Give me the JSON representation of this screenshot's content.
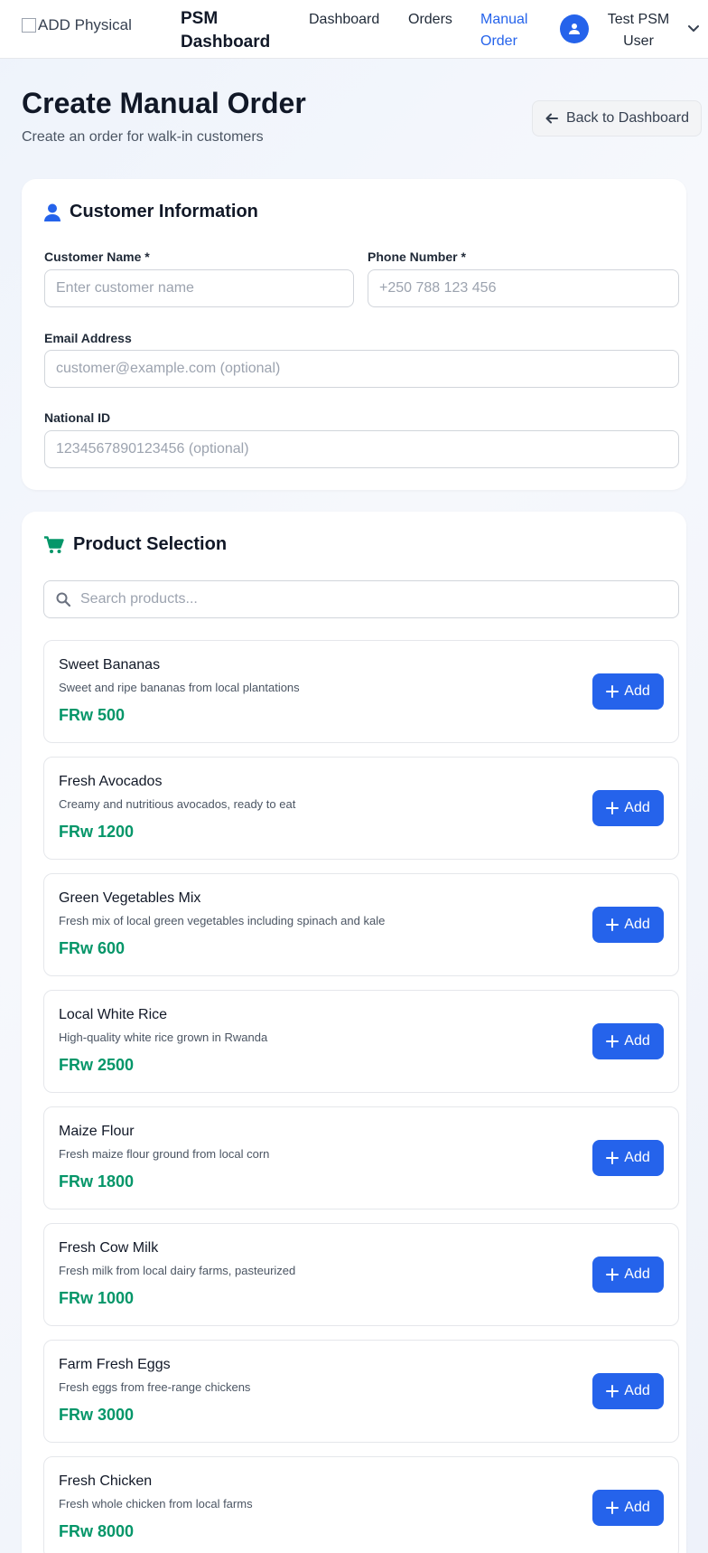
{
  "nav": {
    "logo_alt": "ADD Physical",
    "brand": "PSM Dashboard",
    "links": [
      {
        "label": "Dashboard",
        "active": false
      },
      {
        "label": "Orders",
        "active": false
      },
      {
        "label": "Manual Order",
        "active": true
      }
    ],
    "user_name": "Test PSM User",
    "user_icon": "user-circle-icon",
    "menu_icon": "chevron-down-icon"
  },
  "header": {
    "title": "Create Manual Order",
    "subtitle": "Create an order for walk-in customers",
    "back_label": "Back to Dashboard",
    "back_icon": "arrow-left-icon"
  },
  "customer": {
    "heading": "Customer Information",
    "heading_icon": "user-icon",
    "fields": {
      "name": {
        "label": "Customer Name *",
        "value": "",
        "placeholder": "Enter customer name"
      },
      "phone": {
        "label": "Phone Number *",
        "value": "",
        "placeholder": "+250 788 123 456"
      },
      "email": {
        "label": "Email Address",
        "value": "",
        "placeholder": "customer@example.com (optional)"
      },
      "national_id": {
        "label": "National ID",
        "value": "",
        "placeholder": "1234567890123456 (optional)"
      }
    }
  },
  "products": {
    "heading": "Product Selection",
    "heading_icon": "cart-icon",
    "search": {
      "placeholder": "Search products...",
      "value": "",
      "icon": "search-icon"
    },
    "add_label": "Add",
    "items": [
      {
        "name": "Sweet Bananas",
        "description": "Sweet and ripe bananas from local plantations",
        "price": "FRw 500"
      },
      {
        "name": "Fresh Avocados",
        "description": "Creamy and nutritious avocados, ready to eat",
        "price": "FRw 1200"
      },
      {
        "name": "Green Vegetables Mix",
        "description": "Fresh mix of local green vegetables including spinach and kale",
        "price": "FRw 600"
      },
      {
        "name": "Local White Rice",
        "description": "High-quality white rice grown in Rwanda",
        "price": "FRw 2500"
      },
      {
        "name": "Maize Flour",
        "description": "Fresh maize flour ground from local corn",
        "price": "FRw 1800"
      },
      {
        "name": "Fresh Cow Milk",
        "description": "Fresh milk from local dairy farms, pasteurized",
        "price": "FRw 1000"
      },
      {
        "name": "Farm Fresh Eggs",
        "description": "Fresh eggs from free-range chickens",
        "price": "FRw 3000"
      },
      {
        "name": "Fresh Chicken",
        "description": "Fresh whole chicken from local farms",
        "price": "FRw 8000"
      }
    ]
  },
  "colors": {
    "primary": "#2563eb",
    "price_green": "#059669",
    "background": "#eef3fb"
  }
}
